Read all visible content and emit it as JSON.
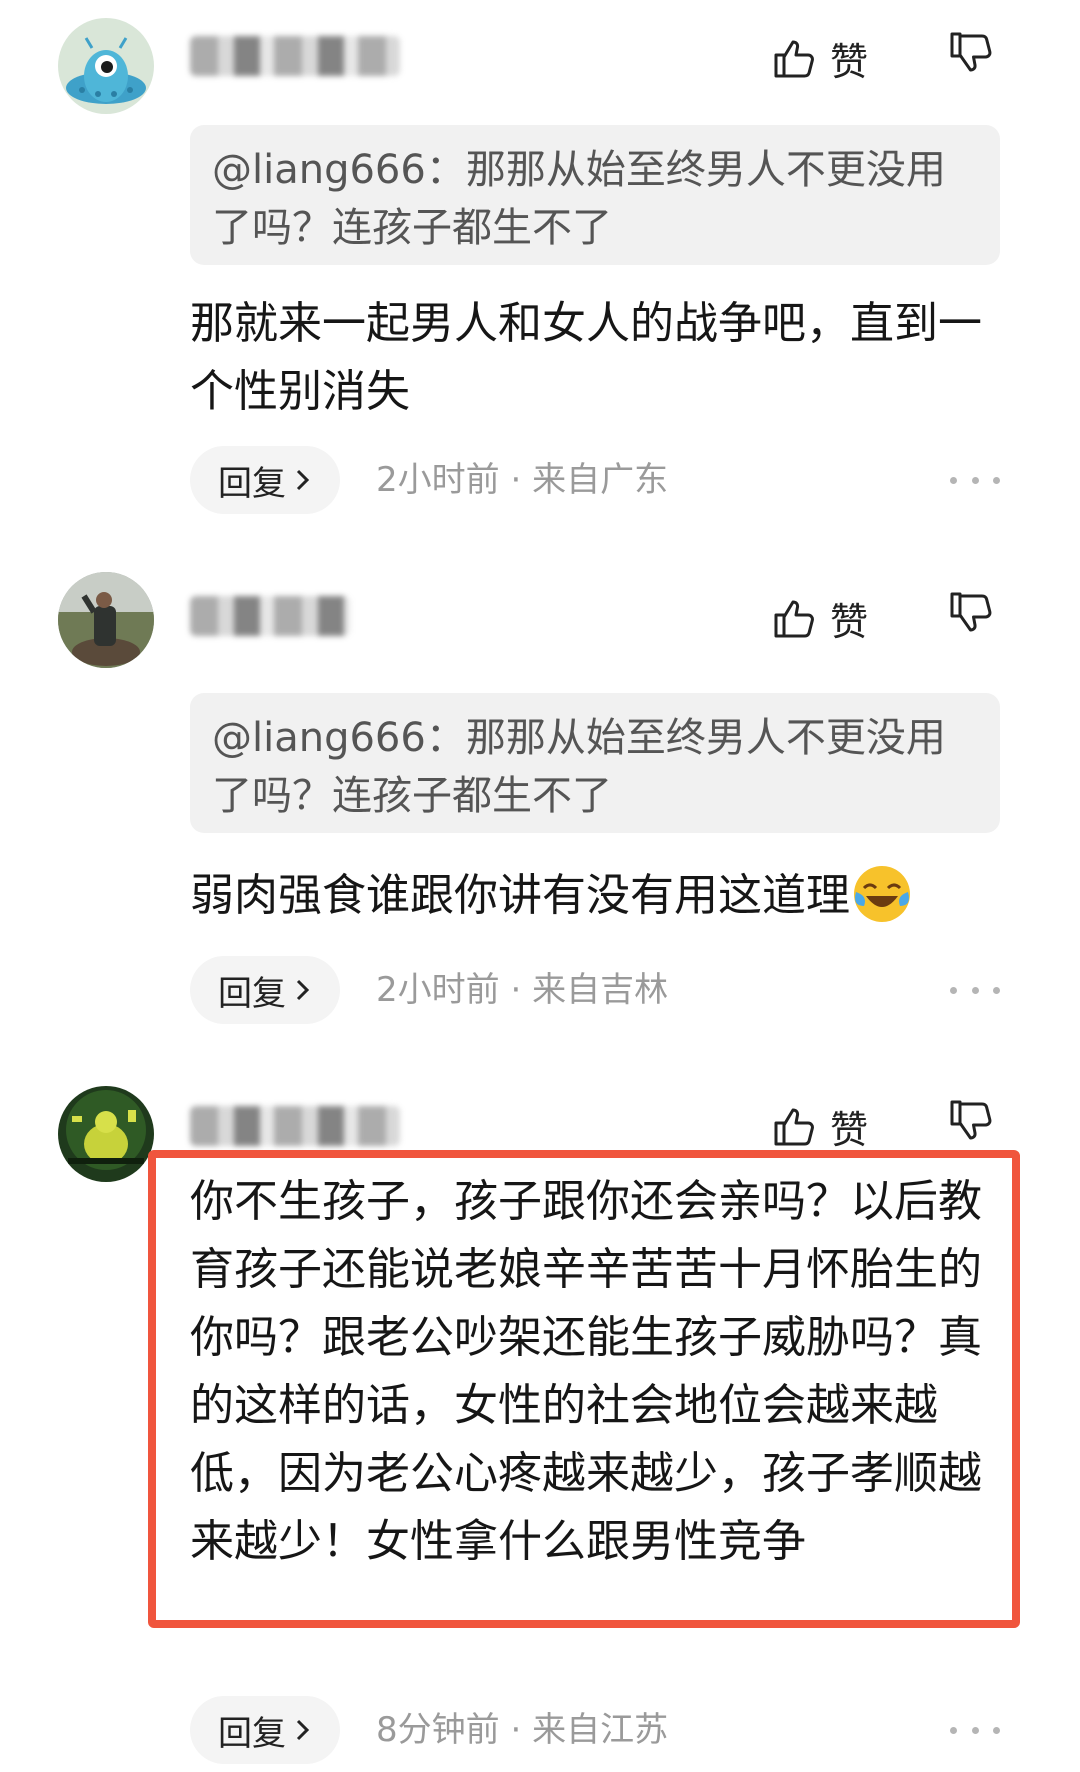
{
  "comments": [
    {
      "username": "",
      "like_label": "赞",
      "quote": "@liang666：那那从始至终男人不更没用了吗？连孩子都生不了",
      "body": "那就来一起男人和女人的战争吧，直到一个性别消失",
      "reply_label": "回复",
      "time": "2小时前",
      "location": "来自广东"
    },
    {
      "username": "",
      "like_label": "赞",
      "quote": "@liang666：那那从始至终男人不更没用了吗？连孩子都生不了",
      "body": "弱肉强食谁跟你讲有没有用这道理",
      "body_emoji": "crying-laughing-emoji",
      "reply_label": "回复",
      "time": "2小时前",
      "location": "来自吉林"
    },
    {
      "username": "",
      "like_label": "赞",
      "body": "你不生孩子，孩子跟你还会亲吗？以后教育孩子还能说老娘辛辛苦苦十月怀胎生的你吗？跟老公吵架还能生孩子威胁吗？真的这样的话，女性的社会地位会越来越低，因为老公心疼越来越少，孩子孝顺越来越少！女性拿什么跟男性竞争",
      "reply_label": "回复",
      "time": "8分钟前",
      "location": "来自江苏"
    }
  ],
  "meta_separator": " · ",
  "colors": {
    "highlight": "#f0553d",
    "quote_bg": "#f1f1f1",
    "meta_text": "#9a9a9a"
  },
  "icons": [
    "thumbs-up-icon",
    "thumbs-down-icon",
    "chevron-right-icon",
    "more-dots-icon"
  ]
}
